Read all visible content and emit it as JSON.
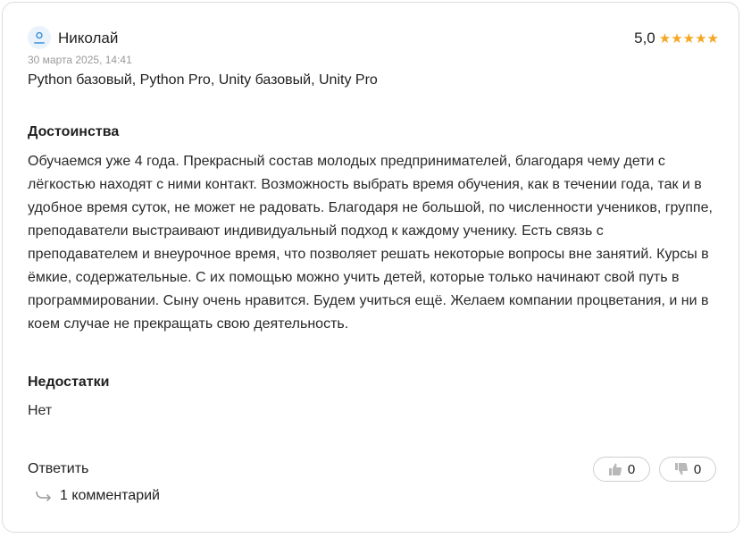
{
  "review": {
    "author": "Николай",
    "rating_value": "5,0",
    "stars": "★★★★★",
    "date": "30 марта 2025, 14:41",
    "courses": "Python базовый, Python Pro, Unity базовый, Unity Pro",
    "pros_title": "Достоинства",
    "pros_text": "Обучаемся уже 4 года. Прекрасный состав молодых предпринимателей, благодаря чему дети с лёгкостью находят с ними контакт. Возможность выбрать время обучения, как в течении года, так и в удобное время суток, не может не радовать. Благодаря не большой, по численности учеников, группе, преподаватели выстраивают индивидуальный подход к каждому ученику. Есть связь с преподавателем и внеурочное время, что позволяет решать некоторые вопросы вне занятий. Курсы в ёмкие, содержательные. С их помощью можно учить детей, которые только начинают свой путь в программировании. Сыну очень нравится. Будем учиться ещё. Желаем компании процветания, и ни в коем случае не прекращать свою деятельность.",
    "cons_title": "Недостатки",
    "cons_text": "Нет"
  },
  "actions": {
    "reply_label": "Ответить",
    "comments_label": "1 комментарий",
    "likes": "0",
    "dislikes": "0"
  },
  "colors": {
    "star": "#f5a623",
    "avatar_bg": "#eaf3fc",
    "avatar_icon": "#3b8fd9",
    "muted": "#9a9a9a"
  },
  "icons": [
    "user-icon",
    "star-icon",
    "reply-arrow-icon",
    "thumbs-up-icon",
    "thumbs-down-icon"
  ]
}
